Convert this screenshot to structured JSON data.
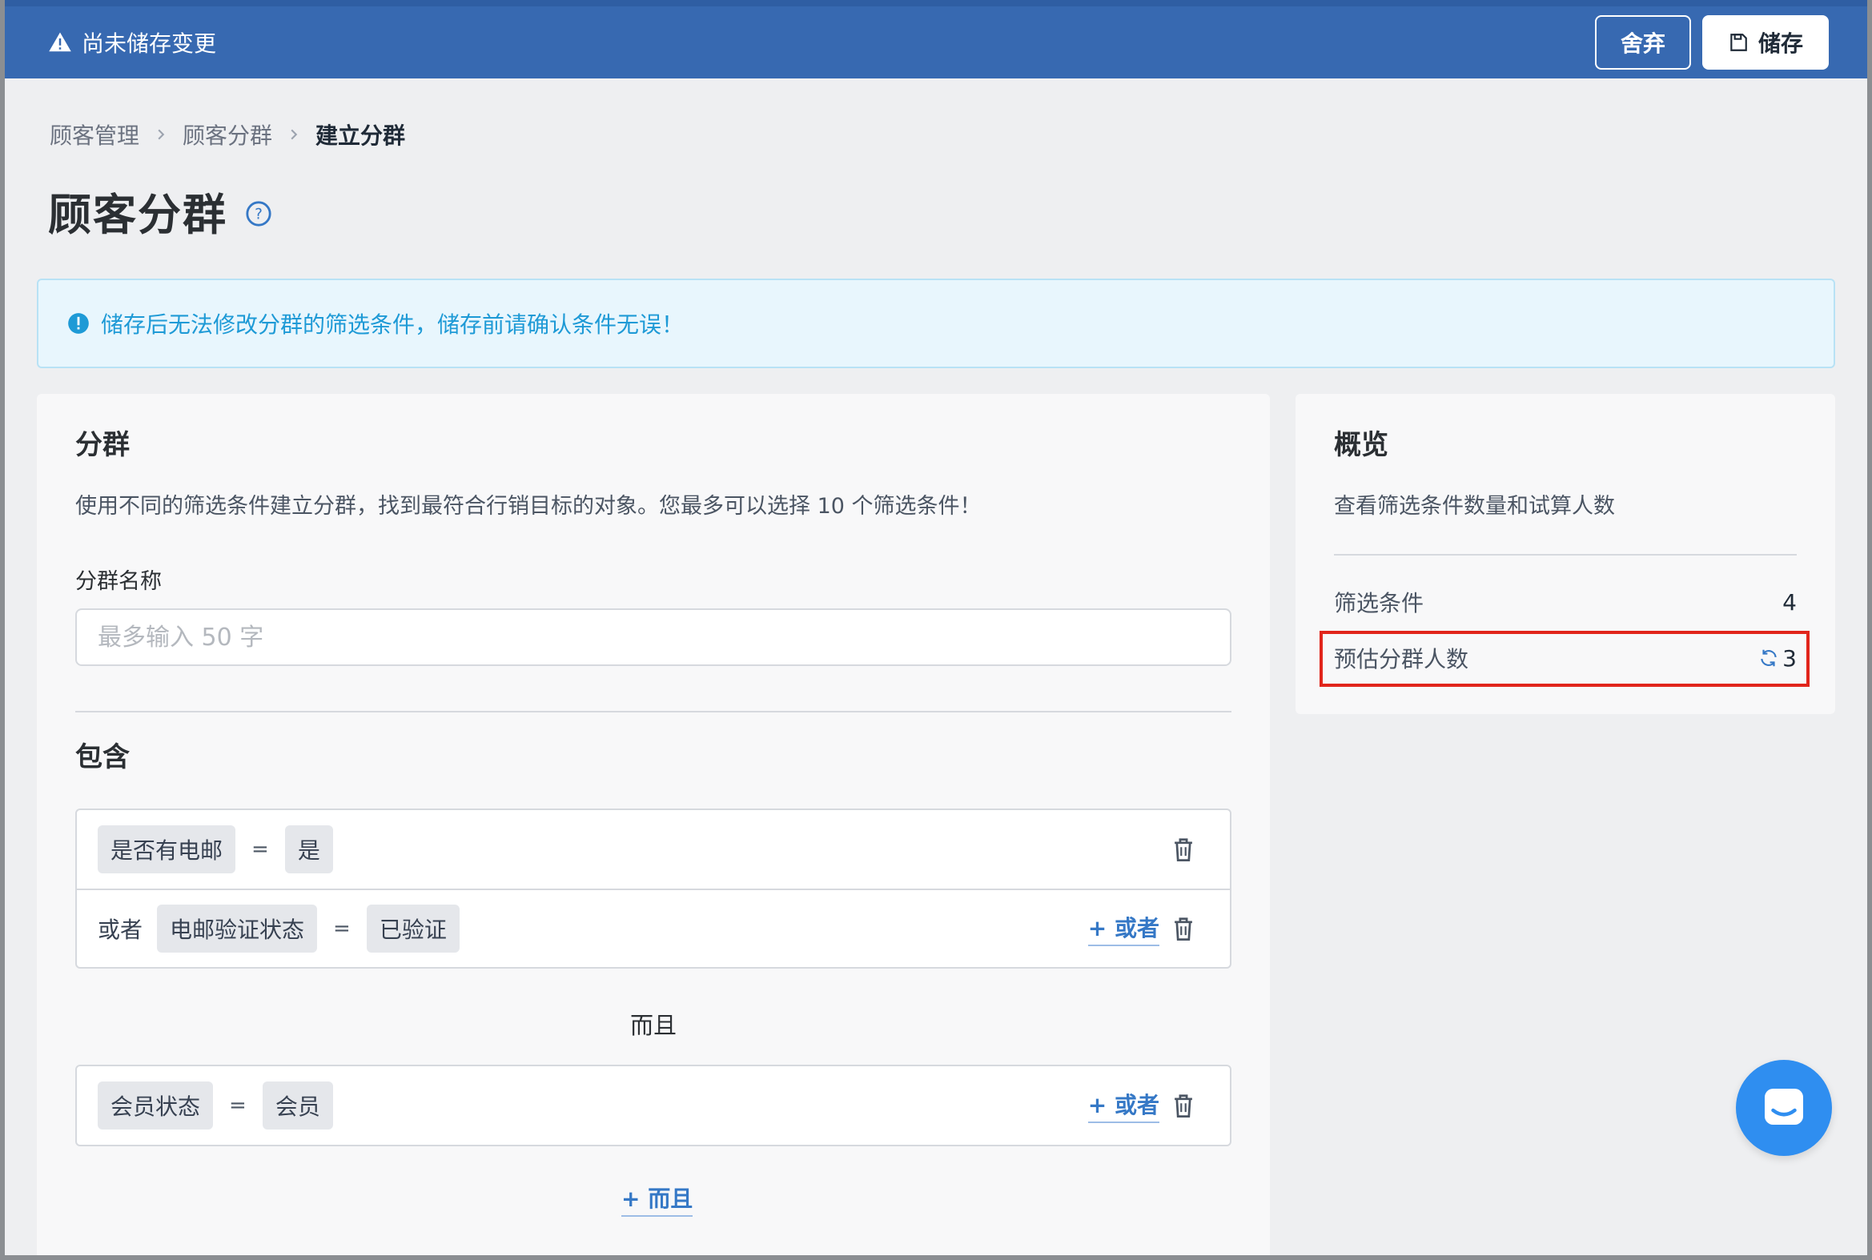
{
  "topbar": {
    "unsaved_text": "尚未储存变更",
    "discard_label": "舍弃",
    "save_label": "储存"
  },
  "breadcrumb": [
    "顾客管理",
    "顾客分群",
    "建立分群"
  ],
  "page": {
    "title": "顾客分群"
  },
  "banner": {
    "text": "储存后无法修改分群的筛选条件，储存前请确认条件无误！"
  },
  "segment": {
    "title": "分群",
    "description": "使用不同的筛选条件建立分群，找到最符合行销目标的对象。您最多可以选择 10 个筛选条件！",
    "name_label": "分群名称",
    "name_placeholder": "最多输入 50 字",
    "include_title": "包含",
    "groups": [
      {
        "conditions": [
          {
            "prefix": "",
            "field": "是否有电邮",
            "operator": "=",
            "value": "是",
            "show_or": false
          },
          {
            "prefix": "或者",
            "field": "电邮验证状态",
            "operator": "=",
            "value": "已验证",
            "show_or": true
          }
        ]
      },
      {
        "conditions": [
          {
            "prefix": "",
            "field": "会员状态",
            "operator": "=",
            "value": "会员",
            "show_or": true
          }
        ]
      }
    ],
    "and_label": "而且",
    "add_or_label": "+ 或者",
    "add_and_label": "+ 而且"
  },
  "overview": {
    "title": "概览",
    "description": "查看筛选条件数量和试算人数",
    "rows": [
      {
        "label": "筛选条件",
        "value": "4"
      },
      {
        "label": "预估分群人数",
        "value": "3"
      }
    ]
  },
  "colors": {
    "topbar": "#3769b1",
    "accent": "#3578c6",
    "info": "#1e9ad6",
    "highlight": "#e1251b",
    "chat": "#2f8ef0"
  },
  "icons": [
    "warning-icon",
    "save-icon",
    "chevron-right-icon",
    "help-icon",
    "info-icon",
    "trash-icon",
    "refresh-icon",
    "chat-icon"
  ]
}
